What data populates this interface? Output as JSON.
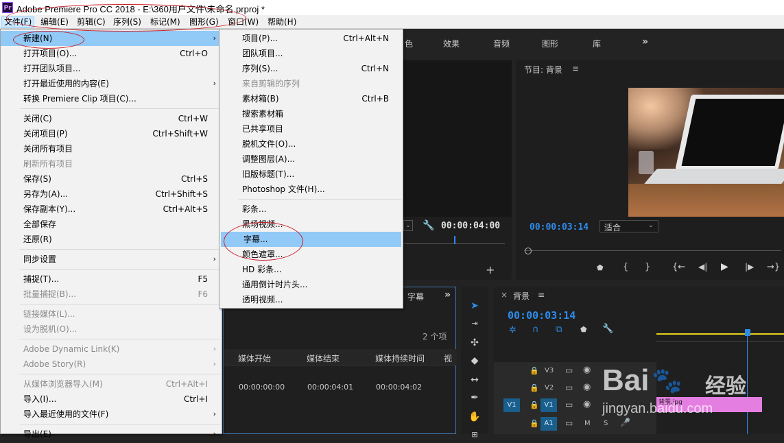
{
  "app": {
    "logo_text": "Pr",
    "window_title": "Adobe Premiere Pro CC 2018 - E:\\360用户文件\\未命名.prproj *"
  },
  "menubar": [
    {
      "label": "文件(F)"
    },
    {
      "label": "编辑(E)"
    },
    {
      "label": "剪辑(C)"
    },
    {
      "label": "序列(S)"
    },
    {
      "label": "标记(M)"
    },
    {
      "label": "图形(G)"
    },
    {
      "label": "窗口(W)"
    },
    {
      "label": "帮助(H)"
    }
  ],
  "file_menu": [
    {
      "label": "新建(N)",
      "shortcut": "",
      "submenu": true,
      "disabled": false,
      "highlight": true
    },
    {
      "label": "打开项目(O)...",
      "shortcut": "Ctrl+O"
    },
    {
      "label": "打开团队项目..."
    },
    {
      "label": "打开最近使用的内容(E)",
      "submenu": true
    },
    {
      "label": "转换 Premiere Clip 项目(C)..."
    },
    {
      "sep": true
    },
    {
      "label": "关闭(C)",
      "shortcut": "Ctrl+W"
    },
    {
      "label": "关闭项目(P)",
      "shortcut": "Ctrl+Shift+W"
    },
    {
      "label": "关闭所有项目"
    },
    {
      "label": "刷新所有项目",
      "disabled": true
    },
    {
      "label": "保存(S)",
      "shortcut": "Ctrl+S"
    },
    {
      "label": "另存为(A)...",
      "shortcut": "Ctrl+Shift+S"
    },
    {
      "label": "保存副本(Y)...",
      "shortcut": "Ctrl+Alt+S"
    },
    {
      "label": "全部保存"
    },
    {
      "label": "还原(R)"
    },
    {
      "sep": true
    },
    {
      "label": "同步设置",
      "submenu": true
    },
    {
      "sep": true
    },
    {
      "label": "捕捉(T)...",
      "shortcut": "F5"
    },
    {
      "label": "批量捕捉(B)...",
      "shortcut": "F6",
      "disabled": true
    },
    {
      "sep": true
    },
    {
      "label": "链接媒体(L)...",
      "disabled": true
    },
    {
      "label": "设为脱机(O)...",
      "disabled": true
    },
    {
      "sep": true
    },
    {
      "label": "Adobe Dynamic Link(K)",
      "submenu": true,
      "disabled": true
    },
    {
      "label": "Adobe Story(R)",
      "submenu": true,
      "disabled": true
    },
    {
      "sep": true
    },
    {
      "label": "从媒体浏览器导入(M)",
      "shortcut": "Ctrl+Alt+I",
      "disabled": true
    },
    {
      "label": "导入(I)...",
      "shortcut": "Ctrl+I"
    },
    {
      "label": "导入最近使用的文件(F)",
      "submenu": true
    },
    {
      "sep": true
    },
    {
      "label": "导出(E)",
      "submenu": true
    }
  ],
  "new_submenu": [
    {
      "label": "项目(P)...",
      "shortcut": "Ctrl+Alt+N"
    },
    {
      "label": "团队项目..."
    },
    {
      "label": "序列(S)...",
      "shortcut": "Ctrl+N"
    },
    {
      "label": "来自剪辑的序列",
      "disabled": true
    },
    {
      "label": "素材箱(B)",
      "shortcut": "Ctrl+B"
    },
    {
      "label": "搜索素材箱"
    },
    {
      "label": "已共享项目"
    },
    {
      "label": "脱机文件(O)..."
    },
    {
      "label": "调整图层(A)..."
    },
    {
      "label": "旧版标题(T)..."
    },
    {
      "label": "Photoshop 文件(H)..."
    },
    {
      "sep": true
    },
    {
      "label": "彩条..."
    },
    {
      "label": "黑场视频..."
    },
    {
      "label": "字幕...",
      "highlight": true
    },
    {
      "label": "颜色遮罩..."
    },
    {
      "label": "HD 彩条..."
    },
    {
      "label": "通用倒计时片头..."
    },
    {
      "label": "透明视频..."
    }
  ],
  "workspace_tabs": [
    "色",
    "效果",
    "音频",
    "图形",
    "库"
  ],
  "workspace_overflow": "»",
  "source_monitor": {
    "timecode": "00:00:04:00"
  },
  "program_monitor": {
    "title": "节目: 背景",
    "menu_glyph": "≡",
    "timecode": "00:00:03:14",
    "fit_label": "适合"
  },
  "project_panel": {
    "tab": "字幕",
    "item_count": "2 个项",
    "columns": [
      "媒体开始",
      "媒体结束",
      "媒体持续时间",
      "视"
    ],
    "row": [
      "00:00:00:00",
      "00:00:04:01",
      "00:00:04:02"
    ]
  },
  "timeline": {
    "close": "×",
    "title": "背景",
    "menu_glyph": "≡",
    "timecode": "00:00:03:14",
    "tracks": [
      {
        "name": "V3"
      },
      {
        "name": "V2"
      },
      {
        "name": "V1",
        "src": "V1"
      },
      {
        "name": "A1",
        "m": "M",
        "s": "S"
      }
    ],
    "clip_label": "背景.jpg"
  },
  "watermark": {
    "brand": "Bai",
    "brand2": "经验",
    "url": "jingyan.baidu.com"
  },
  "colors": {
    "accent_blue": "#2d8ceb",
    "clip_pink": "#e47ee1",
    "highlight": "#91c9f7",
    "annotation_red": "#c81e28"
  }
}
